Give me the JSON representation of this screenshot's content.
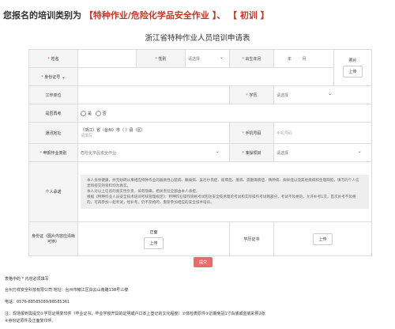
{
  "heading": {
    "prefix": "您报名的培训类别为",
    "category": "【特种作业/危险化学品安全作业 】、 【 初训 】"
  },
  "form_title": "浙江省特种作业人员培训申请表",
  "fields": {
    "name": "姓名",
    "gender": "性别",
    "gender_select": "请选择",
    "birth": "出生年月",
    "year": "年",
    "month": "月",
    "id_type": "身份证号",
    "photo": "照片",
    "upload": "上传",
    "work_unit": "工作单位",
    "education": "学历",
    "education_select": "请选择",
    "reexam": "是否再考",
    "yes": "是",
    "no": "否",
    "address": "通讯地址",
    "address_line": "（浙江）省（台州）市（          ）县（区）",
    "address_placeholder": "请填写",
    "phone": "手机号码",
    "phone_placeholder": "手机号码",
    "job_type": "申报作业类别",
    "job_type_value": "危险化学品安全作业",
    "project": "准操项目",
    "project_select": "请选择",
    "promise_label": "个人承诺",
    "promise_p1": "本人身体健康，并无妨碍从事相应特种作业的器质性心脏病、癫痫病、美尼尔氏症、眩晕症、癔病、震颤麻痹症、精神病、痴呆症以及其他疾病和生理缺陷，填写的个人信息和提交的资料均为真实。",
    "promise_p2": "本人对以上信息的真实性负责，如有隐瞒，相关责任全部由本人承担。",
    "promise_p3": "根据《特种作业人员安全技术培训考核管理规定》：特种作业操作资格考试包括安全技术理论考试和实际操作考试两部分，考试不及格的，允许补考1次，首次补考不及格的，可再参加一起考试，经补考，仍不及格的，重新参加相应的安全技术培训。",
    "id_card": "身份证（图片内容应清晰可辨）",
    "front": "正面",
    "certificate": "学历证书"
  },
  "submit": "提交",
  "footer": {
    "note": "表格中的 * 内容必须填写",
    "company": "台州万祥安全科技有限公司  地址：台州市椒江区白云山南路138号三楼",
    "phone": "电话：0576-88585089/88585361",
    "remark1": "注：现场报到需提交①学历证明复印件（毕业证书、毕业学校开具的证明或户口本上登记的文化程度）②体检表原件③近期免冠1寸白底或蓝底彩照2张",
    "remark2": "④身份证原件及正面复印件。"
  }
}
